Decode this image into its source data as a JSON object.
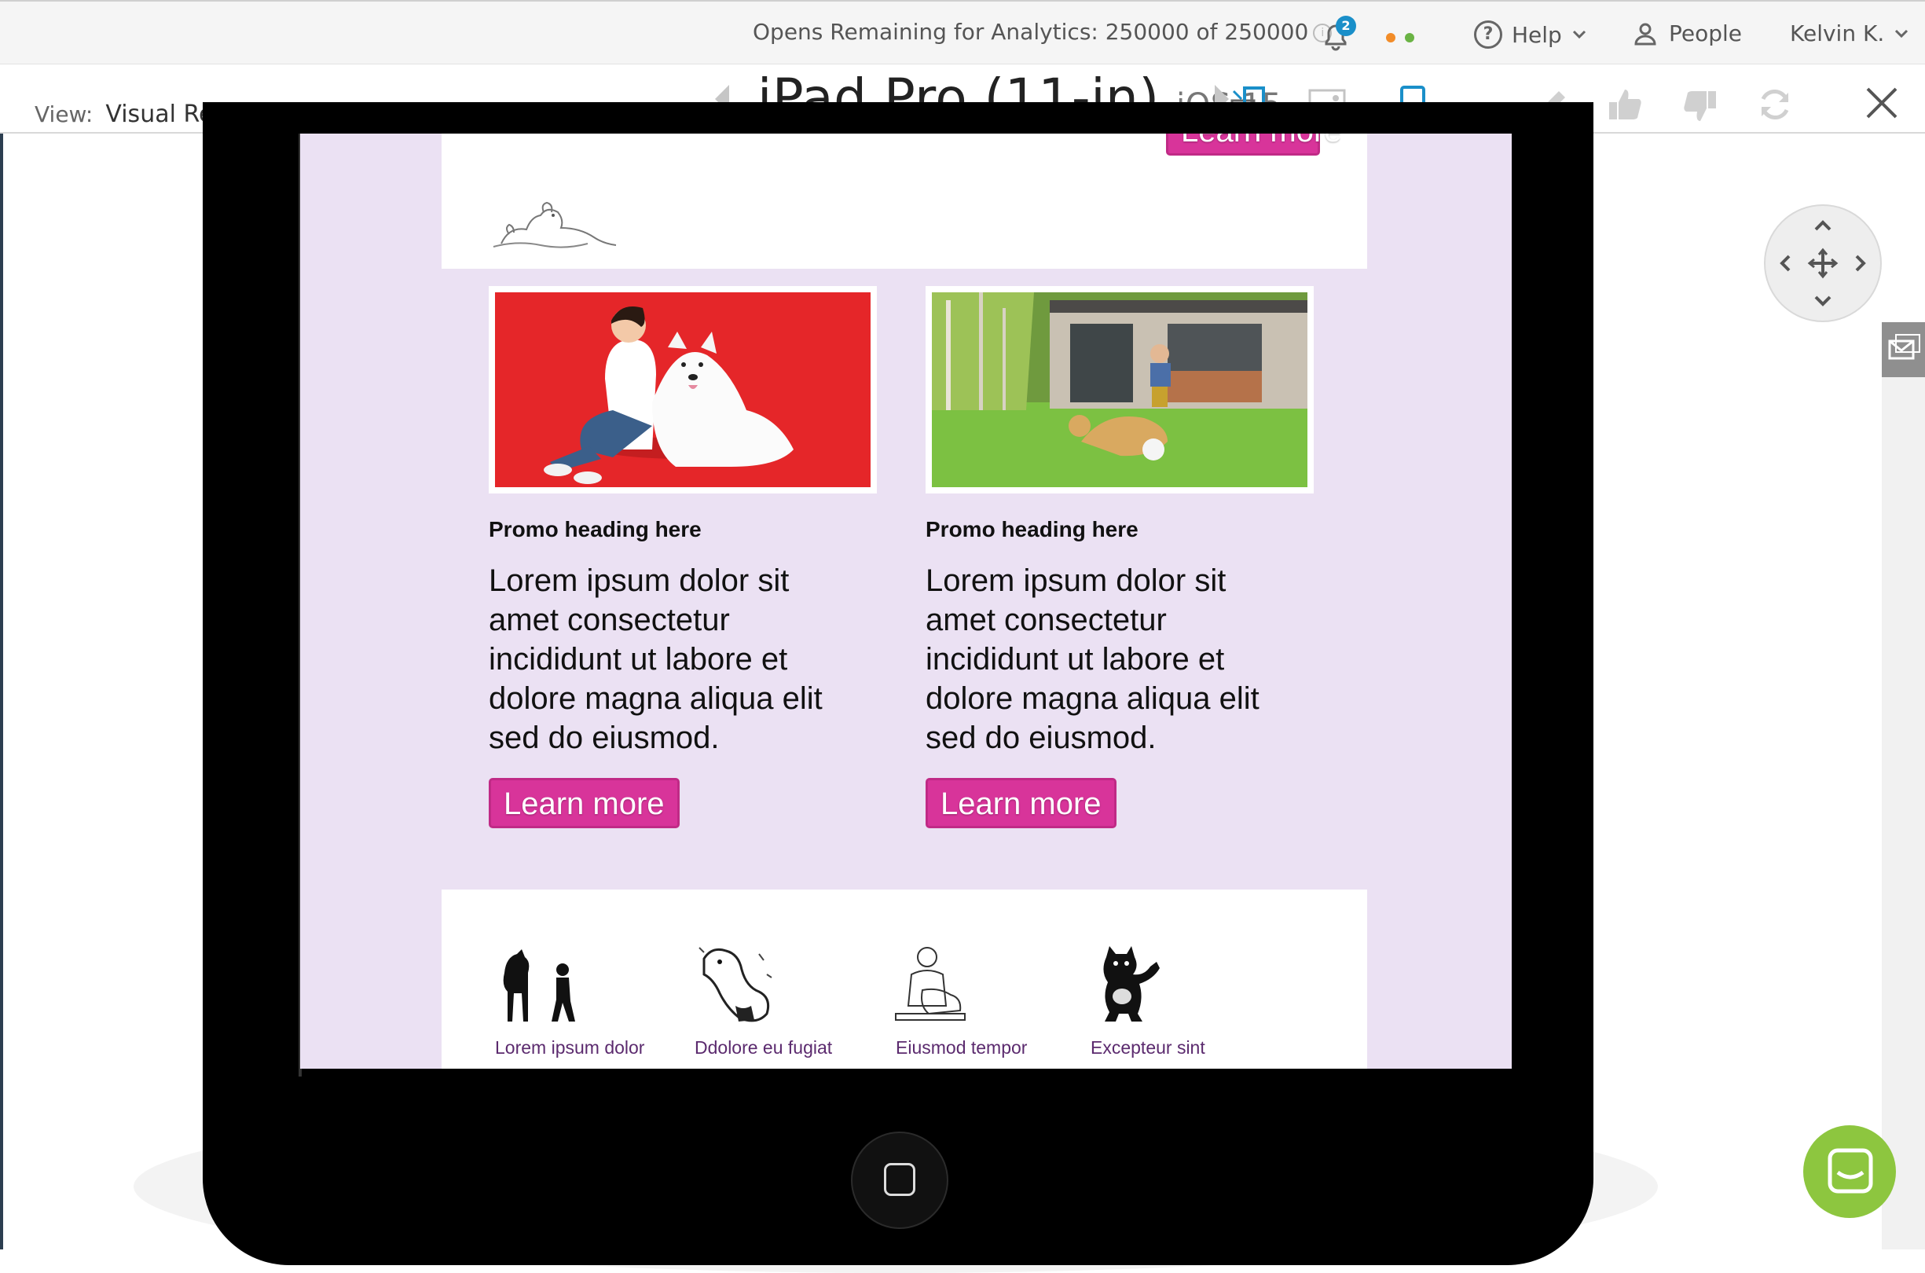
{
  "topbar": {
    "opens_text": "Opens Remaining for Analytics: 250000 of 250000",
    "notification_count": "2",
    "help_label": "Help",
    "people_label": "People",
    "user_label": "Kelvin K."
  },
  "subbar": {
    "view_label": "View:",
    "view_value": "Visual Render",
    "device_name": "iPad Pro (11-in)",
    "device_os": "iOS 15"
  },
  "email": {
    "top_button_label": "Learn more",
    "promos": [
      {
        "heading": "Promo heading here",
        "body": "Lorem ipsum dolor sit amet consectetur incididunt ut labore et dolore magna aliqua elit sed do eiusmod.",
        "button": "Learn more"
      },
      {
        "heading": "Promo heading here",
        "body": "Lorem ipsum dolor sit amet consectetur incididunt ut labore et dolore magna aliqua elit sed do eiusmod.",
        "button": "Learn more"
      }
    ],
    "icon_items": [
      {
        "label": "Lorem ipsum dolor"
      },
      {
        "label": "Ddolore eu fugiat"
      },
      {
        "label": "Eiusmod tempor"
      },
      {
        "label": "Excepteur sint"
      }
    ]
  },
  "colors": {
    "accent_pink": "#d8349a",
    "email_background": "#ebe1f3",
    "chat_green": "#8dc63f",
    "active_blue": "#1a8fc9"
  }
}
